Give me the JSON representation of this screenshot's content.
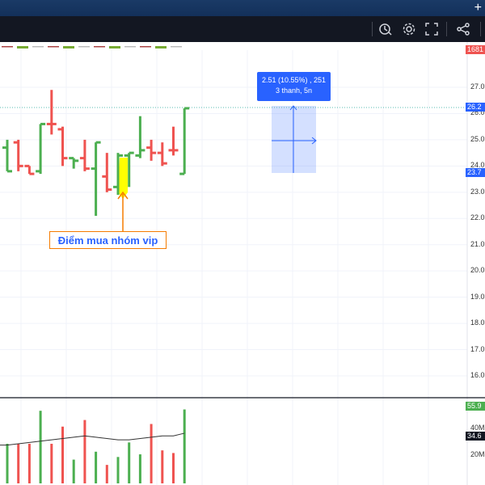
{
  "toolbar": {
    "icons": [
      "alert-clock-icon",
      "settings-gear-icon",
      "fullscreen-icon",
      "share-icon"
    ],
    "top_right_glyph": "+",
    "top_price_tag": "1681"
  },
  "colors": {
    "up": "#4caf50",
    "down": "#ef5350",
    "accent": "#2962ff",
    "annotation_border": "#f57c00",
    "highlight": "#ffff00"
  },
  "price_axis": {
    "labels": [
      "27.0",
      "26.0",
      "25.0",
      "24.0",
      "23.0",
      "22.0",
      "21.0",
      "20.0",
      "19.0",
      "18.0",
      "17.0",
      "16.0"
    ],
    "current_price_tag": "26.2",
    "range_low_tag": "23.7"
  },
  "volume_axis": {
    "labels": [
      "40M",
      "20M"
    ],
    "last_volume_tag": "55.9",
    "ma_volume_tag": "34.6"
  },
  "measure_tool": {
    "line1": "2.51 (10.55%) , 251",
    "line2": "3 thanh, 5n"
  },
  "annotation": {
    "text": "Điểm mua nhóm vip"
  },
  "chart_data": {
    "type": "bar",
    "y_range": [
      15.5,
      28.0
    ],
    "bars": [
      {
        "o": 24.7,
        "h": 25.0,
        "l": 23.8,
        "c": 23.8,
        "dir": "up"
      },
      {
        "o": 24.9,
        "h": 25.0,
        "l": 23.8,
        "c": 24.0,
        "dir": "down"
      },
      {
        "o": 24.0,
        "h": 24.0,
        "l": 23.7,
        "c": 23.7,
        "dir": "down"
      },
      {
        "o": 23.8,
        "h": 25.6,
        "l": 23.7,
        "c": 25.6,
        "dir": "up"
      },
      {
        "o": 25.6,
        "h": 26.9,
        "l": 25.2,
        "c": 25.6,
        "dir": "down"
      },
      {
        "o": 25.4,
        "h": 25.5,
        "l": 24.0,
        "c": 24.3,
        "dir": "down"
      },
      {
        "o": 24.3,
        "h": 24.3,
        "l": 23.9,
        "c": 24.2,
        "dir": "up"
      },
      {
        "o": 24.3,
        "h": 25.0,
        "l": 23.8,
        "c": 23.9,
        "dir": "down"
      },
      {
        "o": 23.9,
        "h": 24.9,
        "l": 22.1,
        "c": 24.9,
        "dir": "up"
      },
      {
        "o": 23.6,
        "h": 24.5,
        "l": 23.0,
        "c": 23.1,
        "dir": "down"
      },
      {
        "o": 23.2,
        "h": 24.5,
        "l": 22.9,
        "c": 24.4,
        "dir": "up"
      },
      {
        "o": 24.4,
        "h": 24.5,
        "l": 23.2,
        "c": 24.5,
        "dir": "up"
      },
      {
        "o": 24.4,
        "h": 25.9,
        "l": 24.3,
        "c": 24.6,
        "dir": "up"
      },
      {
        "o": 24.7,
        "h": 25.0,
        "l": 24.2,
        "c": 24.5,
        "dir": "down"
      },
      {
        "o": 24.5,
        "h": 24.9,
        "l": 24.0,
        "c": 24.1,
        "dir": "down"
      },
      {
        "o": 24.6,
        "h": 25.5,
        "l": 24.4,
        "c": 24.6,
        "dir": "down"
      },
      {
        "o": 23.7,
        "h": 26.2,
        "l": 23.7,
        "c": 26.2,
        "dir": "up"
      }
    ],
    "volume_values": [
      30,
      30,
      30,
      55,
      30,
      43,
      18,
      48,
      24,
      14,
      20,
      31,
      22,
      45,
      25,
      23,
      56
    ],
    "volume_ma": [
      29,
      30,
      31,
      32,
      33,
      34,
      35,
      36,
      35,
      34,
      33,
      33,
      34,
      35,
      36,
      36,
      38
    ],
    "volume_y_range": [
      0,
      60
    ]
  }
}
